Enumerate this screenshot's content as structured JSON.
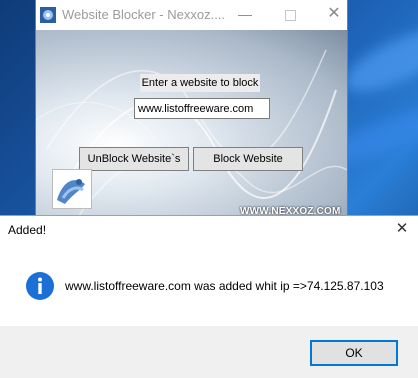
{
  "app_window": {
    "title": "Website Blocker - Nexxoz....",
    "prompt_label": "Enter a website to block",
    "url_value": "www.listoffreeware.com",
    "unblock_label": "UnBlock Website`s",
    "block_label": "Block Website",
    "brand": "WWW.NEXXOZ.COM"
  },
  "dialog": {
    "title": "Added!",
    "message": "www.listoffreeware.com was added whit ip =>74.125.87.103",
    "ok_label": "OK",
    "icon": "info-icon"
  },
  "colors": {
    "desktop": "#1c5fb3",
    "info_icon": "#1c6fd6",
    "focus_border": "#0078d7"
  }
}
